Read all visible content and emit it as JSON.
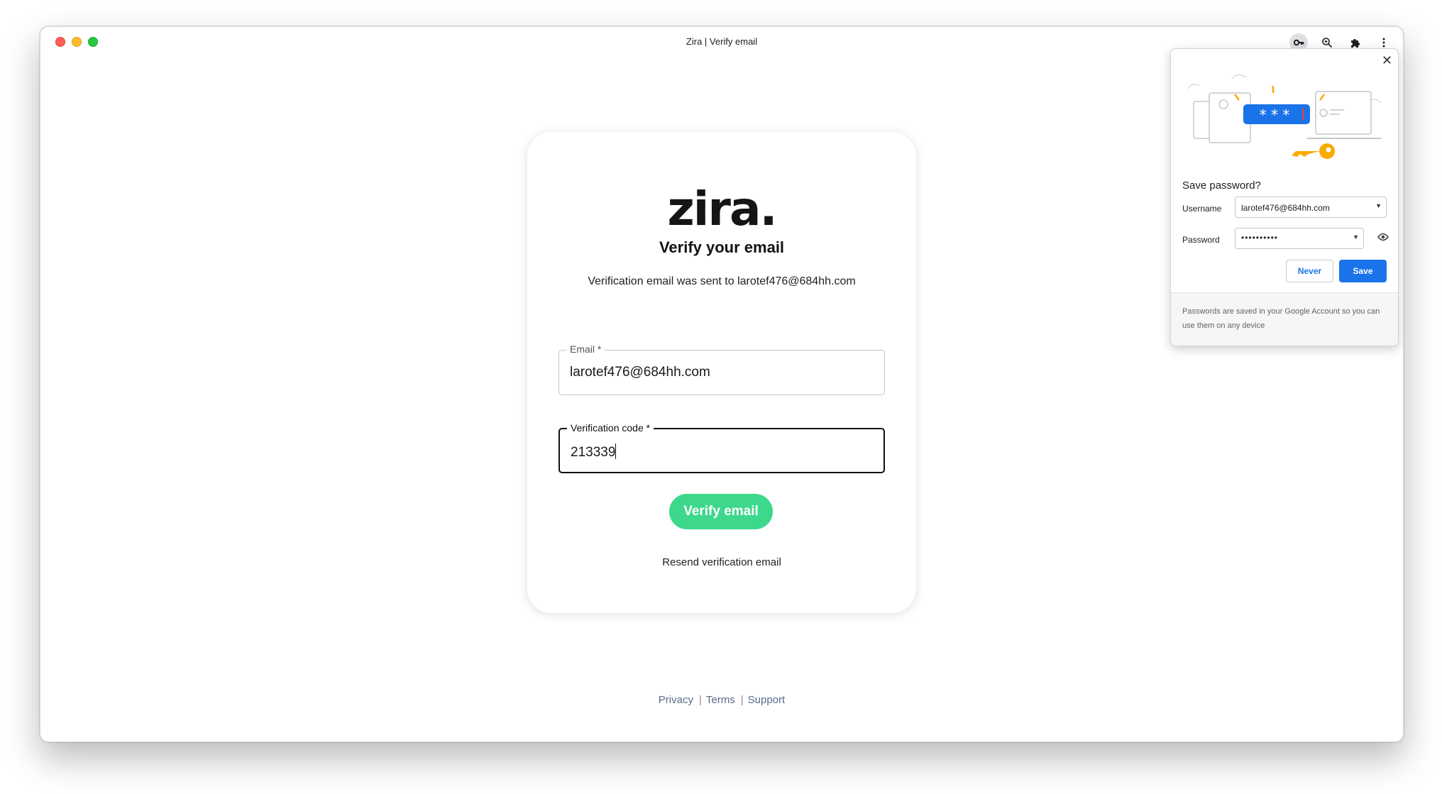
{
  "window": {
    "title": "Zira | Verify email"
  },
  "toolbar": {
    "icons": [
      "key-icon",
      "zoom-icon",
      "extensions-icon",
      "more-icon"
    ]
  },
  "card": {
    "logo": "zira.",
    "heading": "Verify your email",
    "subtext": "Verification email was sent to larotef476@684hh.com",
    "email_field": {
      "label": "Email *",
      "value": "larotef476@684hh.com"
    },
    "code_field": {
      "label": "Verification code *",
      "value": "213339"
    },
    "verify_button": "Verify email",
    "resend_link": "Resend verification email",
    "accent_color": "#3dd88c"
  },
  "footer": {
    "links": [
      "Privacy",
      "Terms",
      "Support"
    ],
    "separator": "|"
  },
  "password_popup": {
    "title": "Save password?",
    "username_label": "Username",
    "username_value": "larotef476@684hh.com",
    "password_label": "Password",
    "password_value": "••••••••••",
    "never_button": "Never",
    "save_button": "Save",
    "footer_text": "Passwords are saved in your Google Account so you can use them on any device",
    "illustration_text": "* * *",
    "accent_color": "#1a73e8"
  }
}
